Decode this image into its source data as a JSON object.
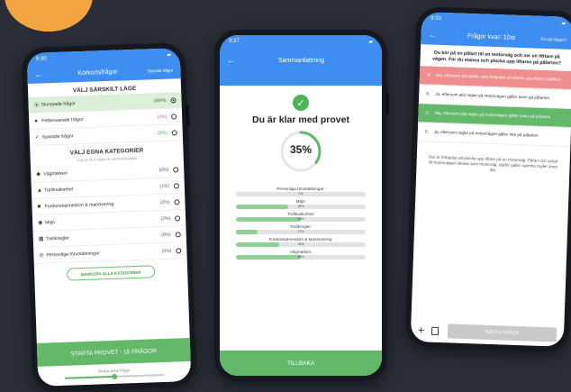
{
  "phone1": {
    "time": "9:30",
    "title": "Körkortsfrågor",
    "link": "Statistik frågor",
    "mode_title": "VÄLJ SÄRSKILT LÄGE",
    "modes": [
      {
        "label": "Slumpade frågor",
        "pct": "(80%)",
        "selected": true
      },
      {
        "label": "Felbesvarade frågor",
        "pct": "(3%)",
        "selected": false
      },
      {
        "label": "Sparade frågor",
        "pct": "(0%)",
        "selected": false
      }
    ],
    "cat_title": "VÄLJ EGNA KATEGORIER",
    "cat_sub": "Välj en till 5 frågor är rekommenderat",
    "categories": [
      {
        "label": "Vägmärken",
        "pct": "(0%)"
      },
      {
        "label": "Trafiksäkerhet",
        "pct": "(1%)"
      },
      {
        "label": "Fordonskännedom & manövering",
        "pct": "(2%)"
      },
      {
        "label": "Miljö",
        "pct": "(2%)"
      },
      {
        "label": "Trafikregler",
        "pct": "(0%)"
      },
      {
        "label": "Personliga förutsättningar",
        "pct": "(0%)"
      }
    ],
    "mark_all": "MARKERA ALLA KATEGORIER",
    "start": "STARTA PROVET - 15 FRÅGOR",
    "change": "Ändra antal frågor",
    "slider_value": 0.5
  },
  "phone2": {
    "time": "9:37",
    "title": "Sammanfattning",
    "ready": "Du är klar med provet",
    "score_label": "35%",
    "score": 0.35,
    "categories": [
      {
        "label": "Personliga förutsättningar:",
        "value": "0%",
        "fill": 0
      },
      {
        "label": "Miljö:",
        "value": "40%",
        "fill": 0.4
      },
      {
        "label": "Trafiksäkerhet:",
        "value": "50%",
        "fill": 0.5
      },
      {
        "label": "Trafikregler:",
        "value": "17%",
        "fill": 0.17
      },
      {
        "label": "Fordonskännedom & Manövrering:",
        "value": "33%",
        "fill": 0.33
      },
      {
        "label": "Vägmärken:",
        "value": "50%",
        "fill": 0.5
      }
    ],
    "back": "TILLBAKA"
  },
  "phone3": {
    "time": "9:33",
    "title": "Frågor kvar: 10st",
    "link": "Fel på frågan?",
    "question": "Du kör på en påfart till en motorväg och ser en lifttare på vägen. För du stanna och plocka upp liftaren på påfarten?",
    "options": [
      {
        "letter": "A.",
        "text": "Nej, eftersom det skulle vara förbjudet att plocka upp liftare i trafiken",
        "state": "red"
      },
      {
        "letter": "B.",
        "text": "Ja, eftersom alla regler på motorvägen gäller även på påfarten",
        "state": ""
      },
      {
        "letter": "C.",
        "text": "Nej, eftersom alla regler på motorvägen gäller även på påfarten",
        "state": "green"
      },
      {
        "letter": "D.",
        "text": "Ja, eftersom regler på motorvägen gäller inte på påfarten",
        "state": ""
      }
    ],
    "explanation": "Det är förbjudet att plocka upp liftare på en motorväg. Påfart och avfart till motorvägen räknas som motorväg, därför gäller samma regler även där.",
    "next": "NÄSTA FRÅGA"
  }
}
